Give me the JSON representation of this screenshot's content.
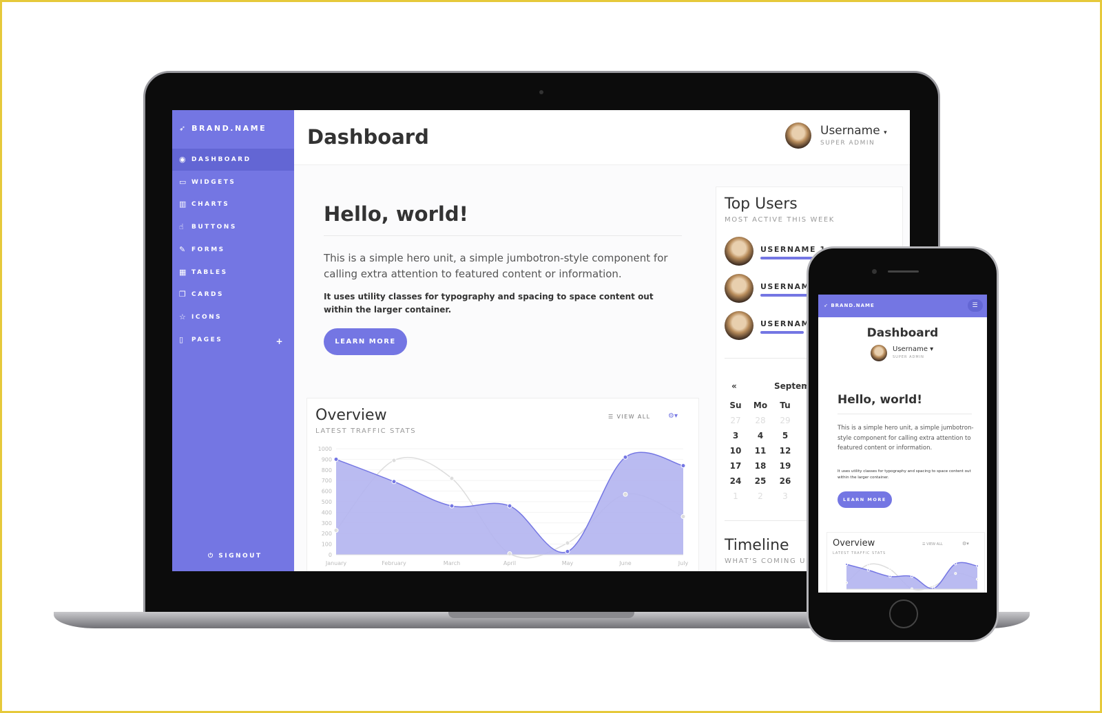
{
  "sidebar": {
    "brand": "BRAND.NAME",
    "items": [
      {
        "label": "DASHBOARD",
        "icon": "dashboard-icon",
        "glyph": "◉",
        "active": true
      },
      {
        "label": "WIDGETS",
        "icon": "calendar-icon",
        "glyph": "▭"
      },
      {
        "label": "CHARTS",
        "icon": "bar-chart-icon",
        "glyph": "▥"
      },
      {
        "label": "BUTTONS",
        "icon": "hand-pointer-icon",
        "glyph": "☝"
      },
      {
        "label": "FORMS",
        "icon": "edit-icon",
        "glyph": "✎"
      },
      {
        "label": "TABLES",
        "icon": "table-icon",
        "glyph": "▦"
      },
      {
        "label": "CARDS",
        "icon": "clone-icon",
        "glyph": "❐"
      },
      {
        "label": "ICONS",
        "icon": "star-icon",
        "glyph": "☆"
      },
      {
        "label": "PAGES",
        "icon": "file-icon",
        "glyph": "▯",
        "expand": "+"
      }
    ],
    "signout": "SIGNOUT"
  },
  "header": {
    "title": "Dashboard",
    "username": "Username",
    "role": "SUPER ADMIN"
  },
  "hero": {
    "title": "Hello, world!",
    "lead": "This is a simple hero unit, a simple jumbotron-style component for calling extra attention to featured content or information.",
    "text": "It uses utility classes for typography and spacing to space content out within the larger container.",
    "button": "LEARN MORE"
  },
  "overview": {
    "title": "Overview",
    "subtitle": "LATEST TRAFFIC STATS",
    "view_all": "VIEW ALL"
  },
  "top_users": {
    "title": "Top Users",
    "subtitle": "MOST ACTIVE THIS WEEK",
    "users": [
      {
        "name": "USERNAME 1",
        "activity": 0.8
      },
      {
        "name": "USERNAME 2",
        "activity": 0.65
      },
      {
        "name": "USERNAME 3",
        "activity": 0.45
      }
    ]
  },
  "calendar": {
    "prev": "«",
    "month": "September",
    "days": [
      "Su",
      "Mo",
      "Tu"
    ],
    "weeks": [
      [
        "27",
        "28",
        "29"
      ],
      [
        "3",
        "4",
        "5"
      ],
      [
        "10",
        "11",
        "12"
      ],
      [
        "17",
        "18",
        "19"
      ],
      [
        "24",
        "25",
        "26"
      ],
      [
        "1",
        "2",
        "3"
      ]
    ]
  },
  "timeline": {
    "title": "Timeline",
    "subtitle": "WHAT'S COMING UP"
  },
  "colors": {
    "accent": "#7476e3",
    "fill": "#b3b4f0",
    "secondary": "#dddddd"
  },
  "chart_data": {
    "type": "area",
    "x": [
      "January",
      "February",
      "March",
      "April",
      "May",
      "June",
      "July"
    ],
    "ylim": [
      0,
      1000
    ],
    "yticks": [
      0,
      100,
      200,
      300,
      400,
      500,
      600,
      700,
      800,
      900,
      1000
    ],
    "series": [
      {
        "values": [
          900,
          690,
          460,
          460,
          30,
          920,
          840
        ],
        "color": "#7476e3"
      },
      {
        "values": [
          230,
          890,
          720,
          10,
          110,
          570,
          360
        ],
        "color": "#dddddd"
      }
    ]
  }
}
